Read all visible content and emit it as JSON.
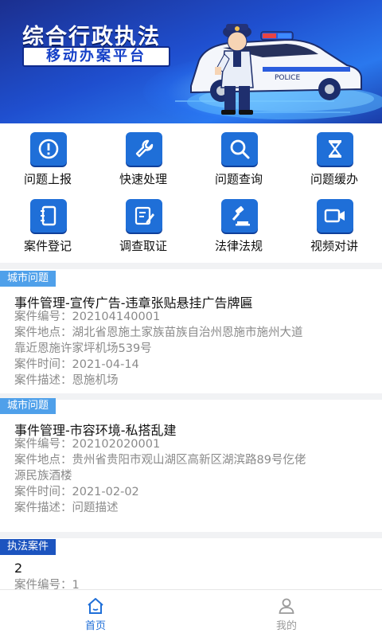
{
  "banner": {
    "title": "综合行政执法",
    "subtitle": "移动办案平台"
  },
  "grid": [
    {
      "label": "问题上报",
      "icon": "alert-circle-icon"
    },
    {
      "label": "快速处理",
      "icon": "wrench-icon"
    },
    {
      "label": "问题查询",
      "icon": "search-icon"
    },
    {
      "label": "问题缓办",
      "icon": "hourglass-icon"
    },
    {
      "label": "案件登记",
      "icon": "notebook-icon"
    },
    {
      "label": "调查取证",
      "icon": "edit-document-icon"
    },
    {
      "label": "法律法规",
      "icon": "gavel-icon"
    },
    {
      "label": "视频对讲",
      "icon": "video-camera-icon"
    }
  ],
  "cases": [
    {
      "tag": "城市问题",
      "title": "事件管理-宣传广告-违章张贴悬挂广告牌匾",
      "number_label": "案件编号：",
      "number": "202104140001",
      "location_label": "案件地点：",
      "location_line1": "湖北省恩施土家族苗族自治州恩施市施州大道",
      "location_line2": "靠近恩施许家坪机场539号",
      "time_label": "案件时间：",
      "time": "2021-04-14",
      "desc_label": "案件描述：",
      "desc": "恩施机场"
    },
    {
      "tag": "城市问题",
      "title": "事件管理-市容环境-私搭乱建",
      "number_label": "案件编号：",
      "number": "202102020001",
      "location_label": "案件地点：",
      "location_line1": "贵州省贵阳市观山湖区高新区湖滨路89号仡佬",
      "location_line2": "源民族酒楼",
      "time_label": "案件时间：",
      "time": "2021-02-02",
      "desc_label": "案件描述：",
      "desc": "问题描述"
    },
    {
      "tag": "执法案件",
      "title": "2",
      "number_label": "案件编号：",
      "number": "1"
    }
  ],
  "tabbar": {
    "home_label": "首页",
    "mine_label": "我的"
  },
  "colors": {
    "accent": "#1f6fd8",
    "tag_city": "#4fa0ea",
    "tag_law": "#1c54bf",
    "tab_active": "#1f6fd8",
    "tab_inactive": "#9a9a9a"
  }
}
